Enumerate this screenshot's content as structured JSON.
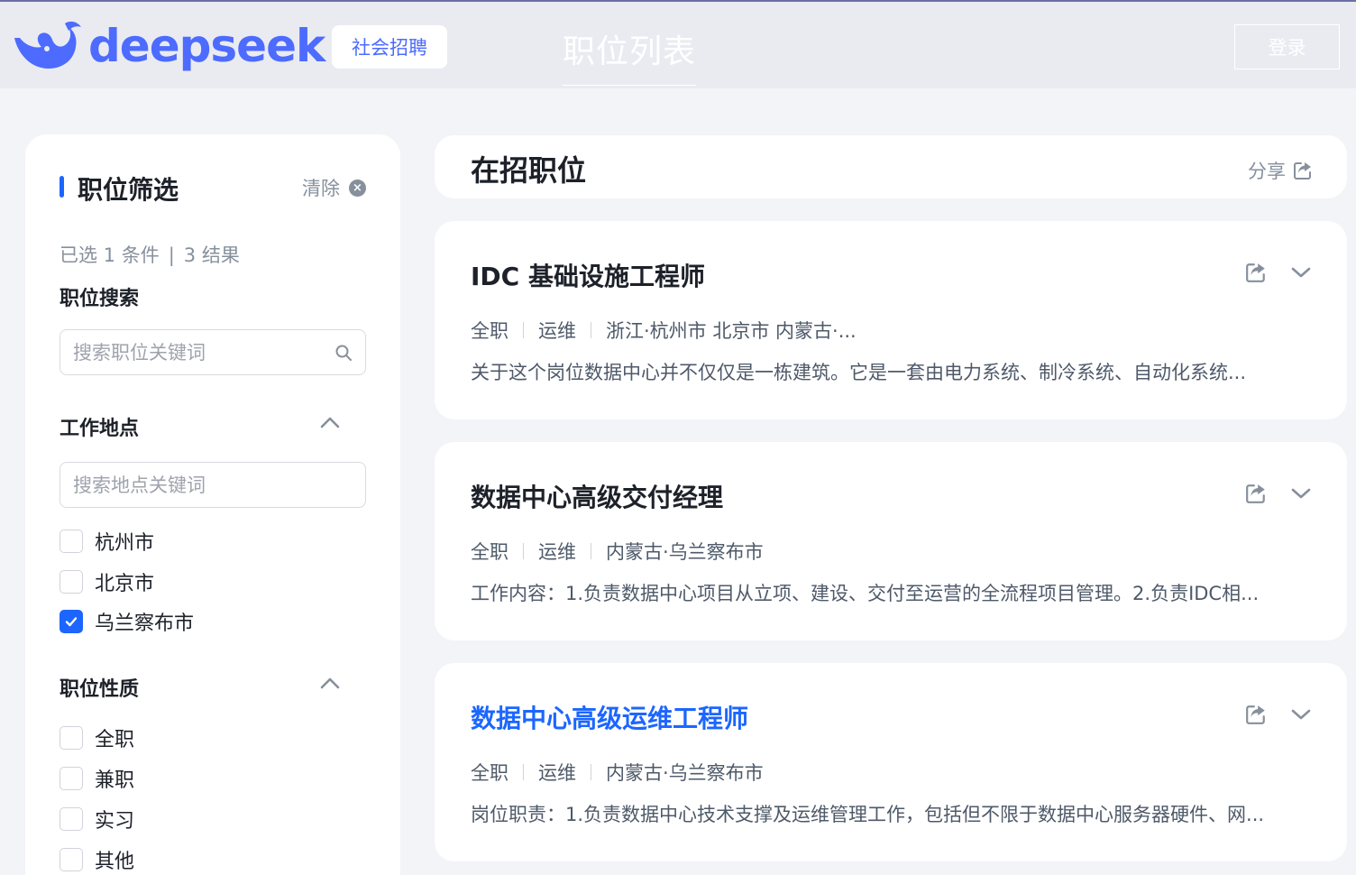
{
  "header": {
    "brand": "deepseek",
    "recruit_label": "社会招聘",
    "nav_title": "职位列表",
    "login_label": "登录",
    "colors": {
      "brand": "#4d6bfe",
      "topbar": "#e9ebf1"
    }
  },
  "sidebar": {
    "title": "职位筛选",
    "clear_label": "清除",
    "summary": {
      "selected": "已选 1 条件",
      "separator": "|",
      "results": "3 结果"
    },
    "job_search": {
      "label": "职位搜索",
      "placeholder": "搜索职位关键词",
      "value": ""
    },
    "location": {
      "label": "工作地点",
      "placeholder": "搜索地点关键词",
      "value": "",
      "options": [
        {
          "label": "杭州市",
          "checked": false
        },
        {
          "label": "北京市",
          "checked": false
        },
        {
          "label": "乌兰察布市",
          "checked": true
        }
      ]
    },
    "nature": {
      "label": "职位性质",
      "options": [
        {
          "label": "全职",
          "checked": false
        },
        {
          "label": "兼职",
          "checked": false
        },
        {
          "label": "实习",
          "checked": false
        },
        {
          "label": "其他",
          "checked": false
        }
      ]
    }
  },
  "main": {
    "title": "在招职位",
    "share_label": "分享",
    "jobs": [
      {
        "title": "IDC 基础设施工程师",
        "type": "全职",
        "category": "运维",
        "location": "浙江·杭州市 北京市 内蒙古·...",
        "description": "关于这个岗位数据中心并不仅仅是一栋建筑。它是一套由电力系统、制冷系统、自动化系统...",
        "active": false
      },
      {
        "title": "数据中心高级交付经理",
        "type": "全职",
        "category": "运维",
        "location": "内蒙古·乌兰察布市",
        "description": "工作内容：1.负责数据中心项目从立项、建设、交付至运营的全流程项目管理。2.负责IDC相...",
        "active": false
      },
      {
        "title": "数据中心高级运维工程师",
        "type": "全职",
        "category": "运维",
        "location": "内蒙古·乌兰察布市",
        "description": "岗位职责：1.负责数据中心技术支撑及运维管理工作，包括但不限于数据中心服务器硬件、网...",
        "active": true
      }
    ]
  }
}
